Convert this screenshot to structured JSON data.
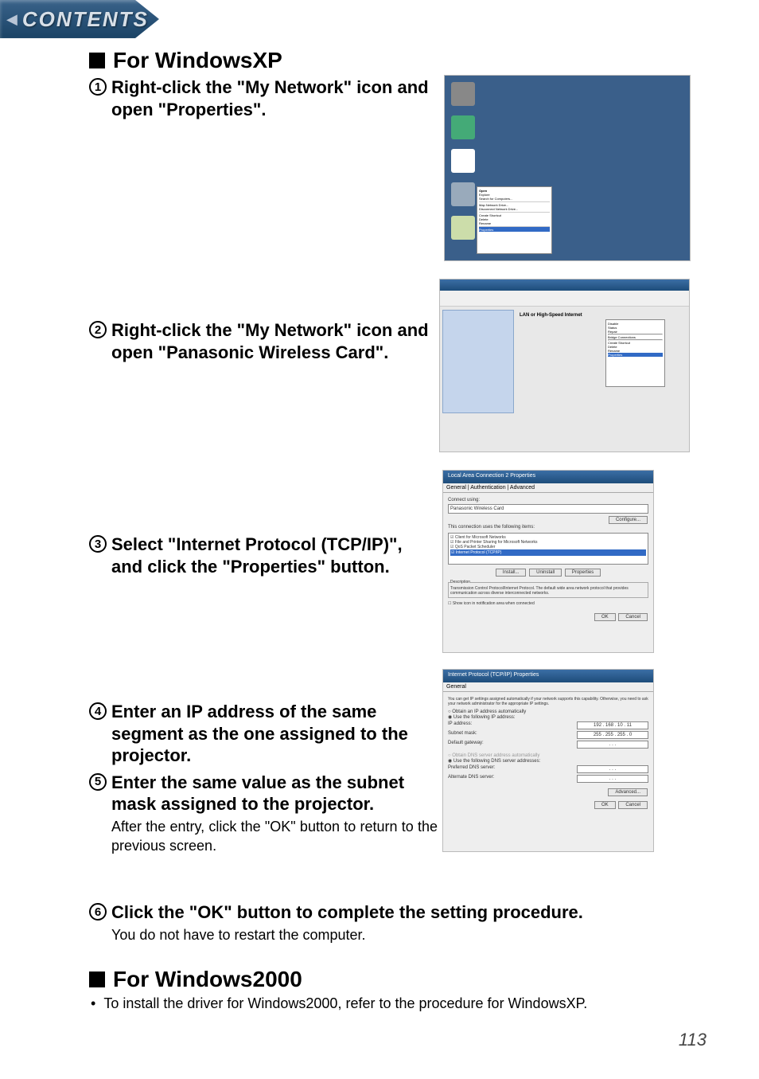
{
  "tab": {
    "label": "CONTENTS"
  },
  "section1": {
    "heading": "For WindowsXP"
  },
  "step1": {
    "title": "Right-click the \"My Network\" icon and open \"Properties\"."
  },
  "step2": {
    "title": "Right-click the \"My Network\" icon and open \"Panasonic Wireless Card\"."
  },
  "step3": {
    "title": "Select \"Internet Protocol (TCP/IP)\", and click the \"Properties\" button."
  },
  "step4": {
    "title": "Enter an IP address of the same segment as the one assigned to the projector."
  },
  "step5": {
    "title": "Enter the same value as the subnet mask assigned to the projector.",
    "body": "After the entry, click the \"OK\" button to return to the previous screen."
  },
  "step6": {
    "title": "Click the \"OK\" button to complete the setting procedure.",
    "body": "You do not have to restart the computer."
  },
  "section2": {
    "heading": "For Windows2000",
    "bullet": "To install the driver for Windows2000, refer to the procedure for WindowsXP."
  },
  "page_number": "113",
  "shot3": {
    "title": "Local Area Connection 2 Properties",
    "tabs": "General | Authentication | Advanced",
    "connect_label": "Connect using:",
    "adapter": "Panasonic Wireless Card",
    "configure": "Configure...",
    "items_label": "This connection uses the following items:",
    "item1": "Client for Microsoft Networks",
    "item2": "File and Printer Sharing for Microsoft Networks",
    "item3": "QoS Packet Scheduler",
    "item4": "Internet Protocol (TCP/IP)",
    "install": "Install...",
    "uninstall": "Uninstall",
    "properties": "Properties",
    "desc_label": "Description",
    "desc_text": "Transmission Control Protocol/Internet Protocol. The default wide area network protocol that provides communication across diverse interconnected networks.",
    "show_icon": "Show icon in notification area when connected",
    "ok": "OK",
    "cancel": "Cancel"
  },
  "shot4": {
    "title": "Internet Protocol (TCP/IP) Properties",
    "tab": "General",
    "desc": "You can get IP settings assigned automatically if your network supports this capability. Otherwise, you need to ask your network administrator for the appropriate IP settings.",
    "obtain_ip": "Obtain an IP address automatically",
    "use_ip": "Use the following IP address:",
    "ip_label": "IP address:",
    "ip_value": "192 . 168 . 10 . 11",
    "subnet_label": "Subnet mask:",
    "subnet_value": "255 . 255 . 255 . 0",
    "gateway_label": "Default gateway:",
    "obtain_dns": "Obtain DNS server address automatically",
    "use_dns": "Use the following DNS server addresses:",
    "pref_dns": "Preferred DNS server:",
    "alt_dns": "Alternate DNS server:",
    "advanced": "Advanced...",
    "ok": "OK",
    "cancel": "Cancel"
  }
}
